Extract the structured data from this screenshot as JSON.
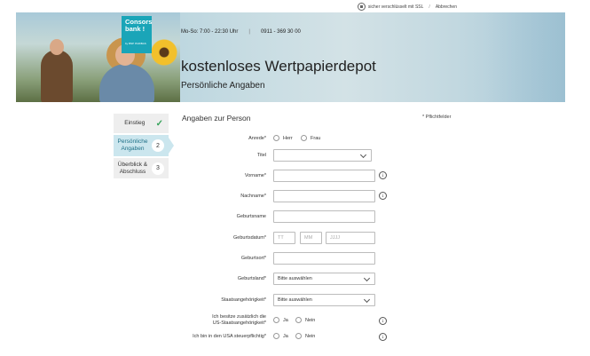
{
  "topbar": {
    "ssl_text": "sicher verschlüsselt mit SSL",
    "separator": "/",
    "cancel_label": "Abbrechen"
  },
  "brand": {
    "name_line1": "Consors",
    "name_line2": "bank !",
    "tagline": "by BNP PARIBAS",
    "color": "#1aa5b8"
  },
  "header": {
    "hours": "Mo-So: 7:00 - 22:30 Uhr",
    "divider": "|",
    "phone": "0911 - 369 30 00",
    "title": "kostenloses Wertpapierdepot",
    "subtitle": "Persönliche Angaben"
  },
  "steps": [
    {
      "label": "Einstieg",
      "state": "done",
      "icon": "check-icon"
    },
    {
      "label": "Persönliche Angaben",
      "number": "2",
      "state": "active"
    },
    {
      "label": "Überblick & Abschluss",
      "number": "3",
      "state": "upcoming"
    }
  ],
  "form": {
    "title": "Angaben zur Person",
    "required_note": "* Pflichtfelder",
    "anrede": {
      "label": "Anrede*",
      "options": [
        "Herr",
        "Frau"
      ]
    },
    "titel": {
      "label": "Titel",
      "value": ""
    },
    "vorname": {
      "label": "Vorname*",
      "value": ""
    },
    "nachname": {
      "label": "Nachname*",
      "value": ""
    },
    "geburtsname": {
      "label": "Geburtsname",
      "value": ""
    },
    "geburtsdatum": {
      "label": "Geburtsdatum*",
      "day": "TT",
      "month": "MM",
      "year": "JJJJ"
    },
    "geburtsort": {
      "label": "Geburtsort*",
      "value": ""
    },
    "geburtsland": {
      "label": "Geburtsland*",
      "value": "Bitte auswählen"
    },
    "staatsangehoerigkeit": {
      "label": "Staatsangehörigkeit*",
      "value": "Bitte auswählen"
    },
    "us_staatsangehoerigkeit": {
      "label_line1": "Ich besitze zusätzlich die",
      "label_line2": "US-Staatsangehörigkeit*",
      "options": [
        "Ja",
        "Nein"
      ]
    },
    "usa_steuerpflichtig": {
      "label": "Ich bin in den USA steuerpflichtig*",
      "options": [
        "Ja",
        "Nein"
      ]
    },
    "info_glyph": "i"
  }
}
